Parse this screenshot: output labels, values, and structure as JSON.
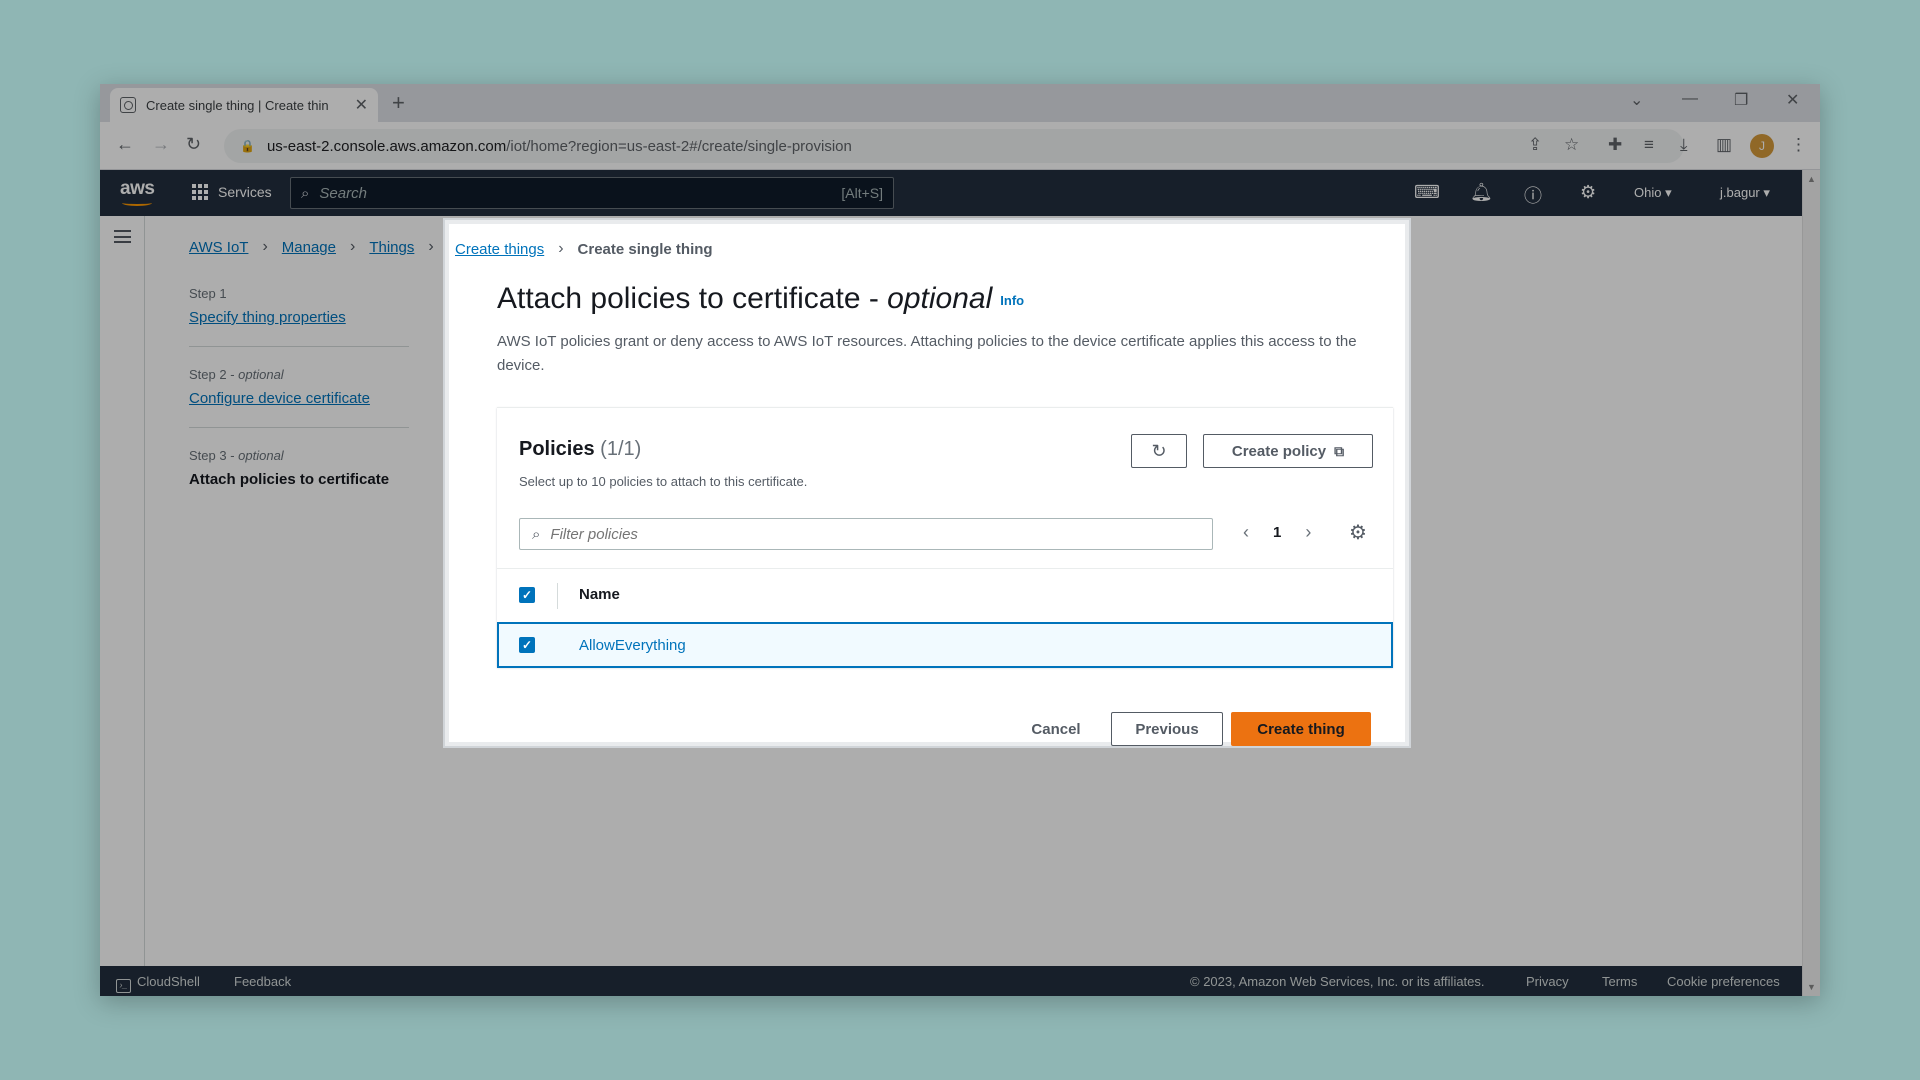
{
  "browser": {
    "tab_title": "Create single thing | Create thin",
    "url_host": "us-east-2.console.aws.amazon.com",
    "url_path": "/iot/home?region=us-east-2#/create/single-provision",
    "profile_initial": "J"
  },
  "topnav": {
    "logo": "aws",
    "services_label": "Services",
    "search_placeholder": "Search",
    "search_shortcut": "[Alt+S]",
    "region": "Ohio ▾",
    "user": "j.bagur ▾"
  },
  "breadcrumb": {
    "items": [
      "AWS IoT",
      "Manage",
      "Things"
    ]
  },
  "steps": [
    {
      "label": "Step 1",
      "optional": "",
      "title": "Specify thing properties"
    },
    {
      "label": "Step 2",
      "optional": "optional",
      "title": "Configure device certificate"
    },
    {
      "label": "Step 3",
      "optional": "optional",
      "title": "Attach policies to certificate"
    }
  ],
  "panel": {
    "crumb_link": "Create things",
    "crumb_current": "Create single thing",
    "title_main": "Attach policies to certificate - ",
    "title_optional": "optional",
    "info_label": "Info",
    "description": "AWS IoT policies grant or deny access to AWS IoT resources. Attaching policies to the device certificate applies this access to the device.",
    "policies": {
      "title": "Policies",
      "count": "(1/1)",
      "subtitle": "Select up to 10 policies to attach to this certificate.",
      "create_policy_label": "Create policy",
      "filter_placeholder": "Filter policies",
      "page": "1",
      "column_name": "Name",
      "rows": [
        {
          "name": "AllowEverything",
          "checked": true
        }
      ]
    },
    "cancel_label": "Cancel",
    "previous_label": "Previous",
    "create_thing_label": "Create thing"
  },
  "footer": {
    "cloudshell": "CloudShell",
    "feedback": "Feedback",
    "copyright": "© 2023, Amazon Web Services, Inc. or its affiliates.",
    "privacy": "Privacy",
    "terms": "Terms",
    "cookies": "Cookie preferences"
  }
}
